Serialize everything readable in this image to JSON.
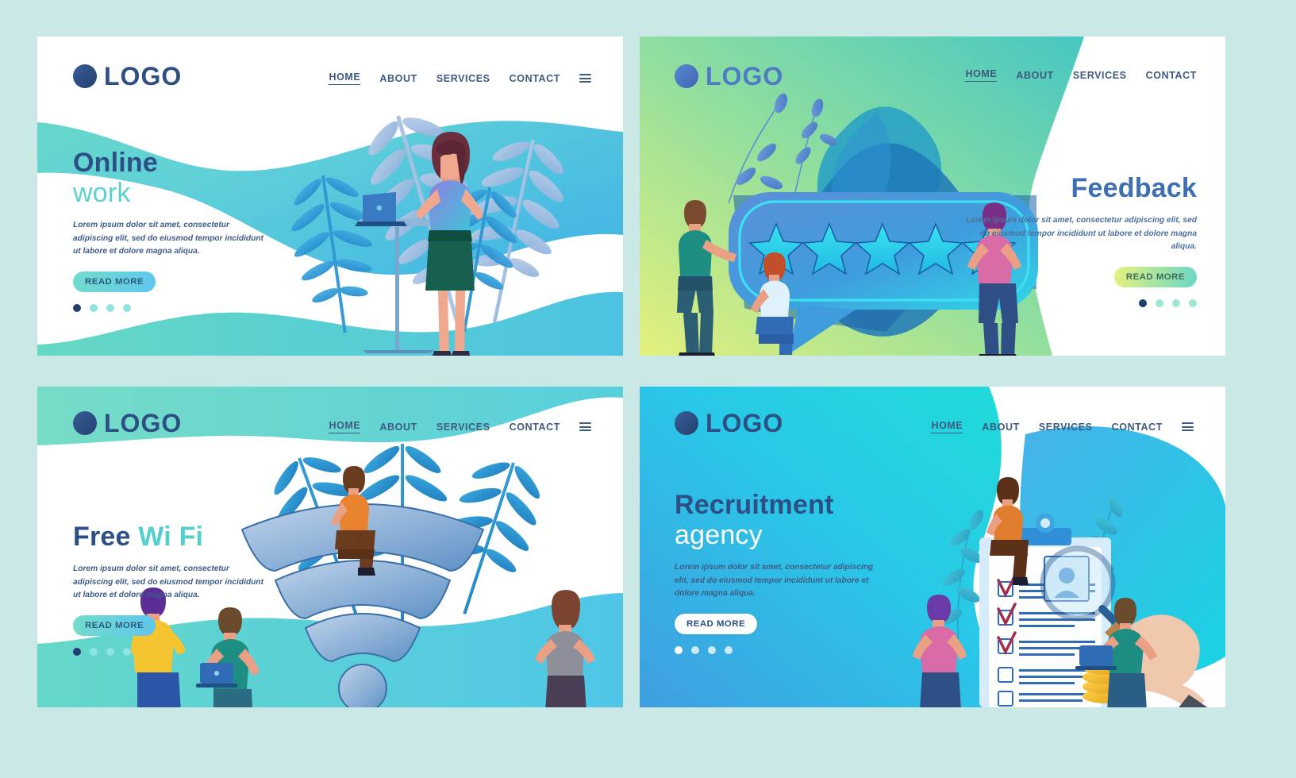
{
  "meta": {
    "page_background": "#c9e8e6",
    "panel_count": 4
  },
  "shared": {
    "logo_text": "LOGO",
    "nav": [
      {
        "label": "HOME",
        "active": true
      },
      {
        "label": "ABOUT",
        "active": false
      },
      {
        "label": "SERVICES",
        "active": false
      },
      {
        "label": "CONTACT",
        "active": false
      }
    ],
    "menu_icon": "hamburger-menu-icon",
    "body_text": "Lorem ipsum dolor sit amet, consectetur adipiscing elit, sed do eiusmod tempor incididunt ut labore et dolore magna aliqua.",
    "cta_label": "READ MORE",
    "pagination_total": 4,
    "pagination_active_index": 0
  },
  "panels": [
    {
      "id": "online-work",
      "title_line1": "Online",
      "title_line2": "work",
      "title_color": "#2c4f86",
      "accent_color": "#5ad3cf",
      "button_gradient": [
        "#72dccb",
        "#5fc6f0"
      ],
      "illustration": "woman-standing-at-laptop-podium-with-palm-leaves"
    },
    {
      "id": "feedback",
      "title_line1": "Feedback",
      "title_line2": "",
      "title_color": "#3e6fb5",
      "accent_color": "#e8f17e",
      "button_gradient": [
        "#e8f17e",
        "#67d7c6"
      ],
      "stars": 5,
      "illustration": "speech-bubble-with-five-stars-and-two-women"
    },
    {
      "id": "free-wifi",
      "title_line1": "Free",
      "title_line2": "Wi Fi",
      "title_color": "#2c4f86",
      "accent_color": "#53cfd0",
      "button_gradient": [
        "#72dccb",
        "#5fc6f0"
      ],
      "illustration": "giant-wifi-symbol-with-people-and-palm-leaves"
    },
    {
      "id": "recruitment-agency",
      "title_line1": "Recruitment",
      "title_line2": "agency",
      "title_color": "#2c4f86",
      "accent_color": "#ffffff",
      "button_gradient": [
        "#ffffff",
        "#ffffff"
      ],
      "illustration": "clipboard-checklist-with-magnifier-hand-coins-and-people"
    }
  ]
}
